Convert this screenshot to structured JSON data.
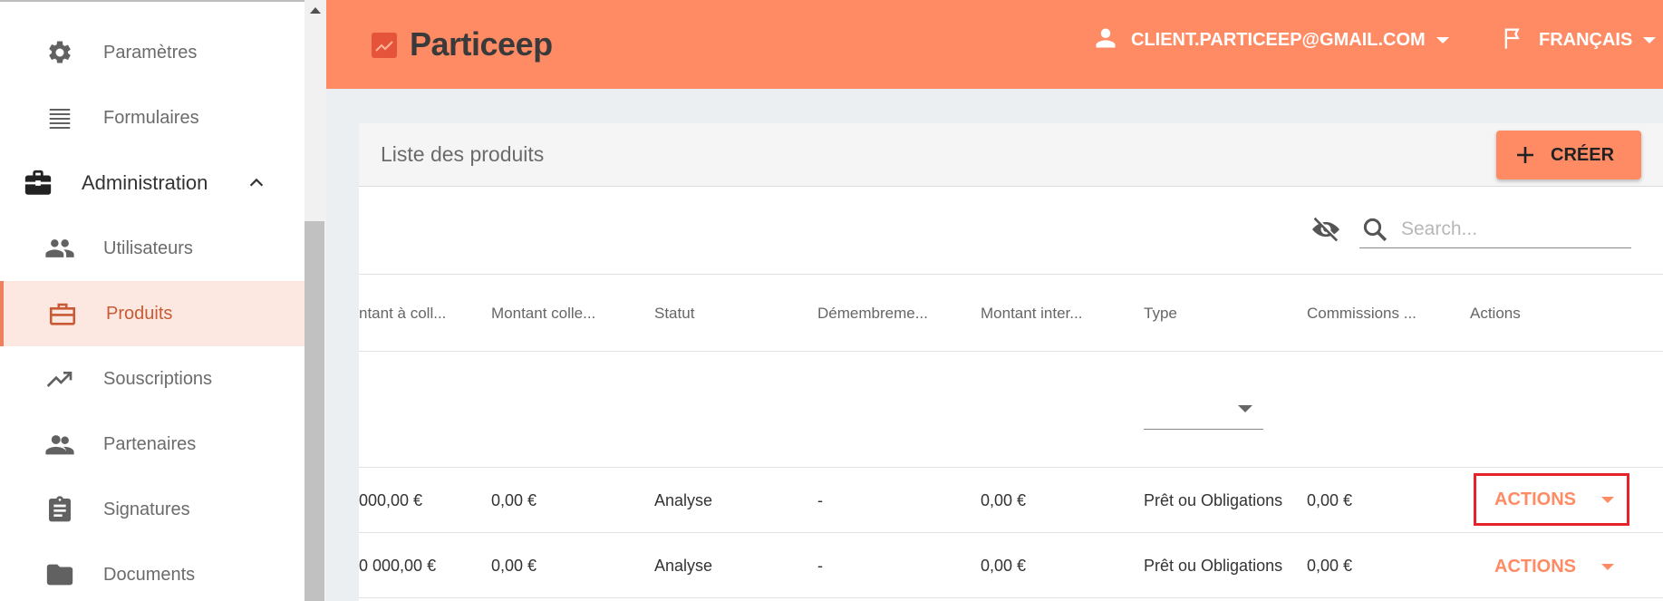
{
  "sidebar": {
    "items": [
      {
        "label": "Paramètres",
        "icon": "gear-icon"
      },
      {
        "label": "Formulaires",
        "icon": "list-icon"
      },
      {
        "label": "Administration",
        "icon": "briefcase-icon"
      },
      {
        "label": "Utilisateurs",
        "icon": "people-icon"
      },
      {
        "label": "Produits",
        "icon": "briefcase-outline-icon"
      },
      {
        "label": "Souscriptions",
        "icon": "trending-up-icon"
      },
      {
        "label": "Partenaires",
        "icon": "partners-icon"
      },
      {
        "label": "Signatures",
        "icon": "clipboard-icon"
      },
      {
        "label": "Documents",
        "icon": "folder-icon"
      }
    ]
  },
  "header": {
    "brand": "Particeep",
    "user_email": "CLIENT.PARTICEEP@GMAIL.COM",
    "language": "FRANÇAIS"
  },
  "card": {
    "title": "Liste des produits",
    "create_label": "CRÉER",
    "search_placeholder": "Search..."
  },
  "table": {
    "columns": [
      "ntant à coll...",
      "Montant colle...",
      "Statut",
      "Démembreme...",
      "Montant inter...",
      "Type",
      "Commissions ...",
      "Actions"
    ],
    "rows": [
      {
        "cells": [
          "000,00 €",
          "0,00 €",
          "Analyse",
          "-",
          "0,00 €",
          "Prêt ou Obligations",
          "0,00 €"
        ],
        "action": "ACTIONS"
      },
      {
        "cells": [
          "0 000,00 €",
          "0,00 €",
          "Analyse",
          "-",
          "0,00 €",
          "Prêt ou Obligations",
          "0,00 €"
        ],
        "action": "ACTIONS"
      }
    ]
  },
  "colors": {
    "accent": "#ff8b65",
    "active_bg": "#fde8e1",
    "highlight": "#e5232a"
  }
}
